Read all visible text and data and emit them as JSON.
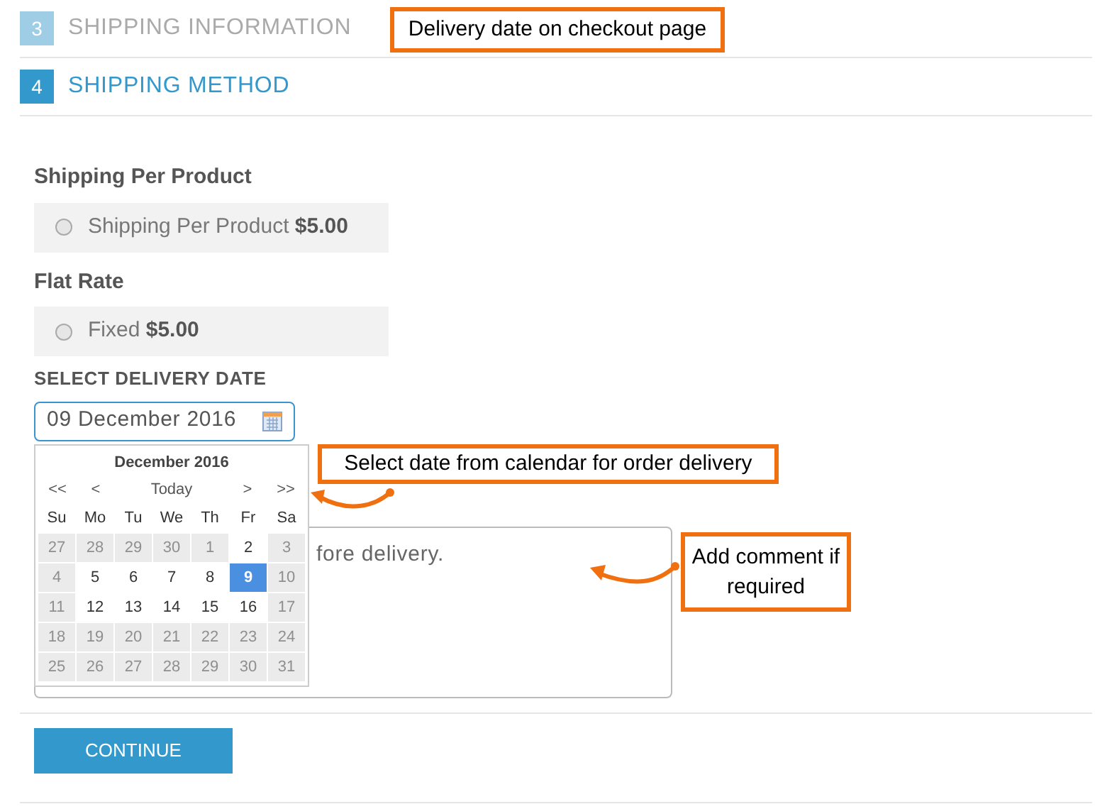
{
  "steps": [
    {
      "number": "3",
      "title": "SHIPPING INFORMATION",
      "active": false
    },
    {
      "number": "4",
      "title": "SHIPPING METHOD",
      "active": true
    }
  ],
  "methods": [
    {
      "heading": "Shipping Per Product",
      "option": "Shipping Per Product",
      "price": "$5.00",
      "selected": false
    },
    {
      "heading": "Flat Rate",
      "option": "Fixed",
      "price": "$5.00",
      "selected": false
    }
  ],
  "delivery_date": {
    "label": "SELECT DELIVERY DATE",
    "value": "09 December 2016"
  },
  "calendar": {
    "month": "December 2016",
    "nav": [
      "<<",
      "<",
      "Today",
      ">",
      ">>"
    ],
    "weekdays": [
      "Su",
      "Mo",
      "Tu",
      "We",
      "Th",
      "Fr",
      "Sa"
    ],
    "weeks": [
      [
        {
          "day": "27",
          "disabled": true,
          "selected": false
        },
        {
          "day": "28",
          "disabled": true,
          "selected": false
        },
        {
          "day": "29",
          "disabled": true,
          "selected": false
        },
        {
          "day": "30",
          "disabled": true,
          "selected": false
        },
        {
          "day": "1",
          "disabled": true,
          "selected": false
        },
        {
          "day": "2",
          "disabled": false,
          "selected": false
        },
        {
          "day": "3",
          "disabled": true,
          "selected": false
        }
      ],
      [
        {
          "day": "4",
          "disabled": true,
          "selected": false
        },
        {
          "day": "5",
          "disabled": false,
          "selected": false
        },
        {
          "day": "6",
          "disabled": false,
          "selected": false
        },
        {
          "day": "7",
          "disabled": false,
          "selected": false
        },
        {
          "day": "8",
          "disabled": false,
          "selected": false
        },
        {
          "day": "9",
          "disabled": false,
          "selected": true
        },
        {
          "day": "10",
          "disabled": true,
          "selected": false
        }
      ],
      [
        {
          "day": "11",
          "disabled": true,
          "selected": false
        },
        {
          "day": "12",
          "disabled": false,
          "selected": false
        },
        {
          "day": "13",
          "disabled": false,
          "selected": false
        },
        {
          "day": "14",
          "disabled": false,
          "selected": false
        },
        {
          "day": "15",
          "disabled": false,
          "selected": false
        },
        {
          "day": "16",
          "disabled": false,
          "selected": false
        },
        {
          "day": "17",
          "disabled": true,
          "selected": false
        }
      ],
      [
        {
          "day": "18",
          "disabled": true,
          "selected": false
        },
        {
          "day": "19",
          "disabled": true,
          "selected": false
        },
        {
          "day": "20",
          "disabled": true,
          "selected": false
        },
        {
          "day": "21",
          "disabled": true,
          "selected": false
        },
        {
          "day": "22",
          "disabled": true,
          "selected": false
        },
        {
          "day": "23",
          "disabled": true,
          "selected": false
        },
        {
          "day": "24",
          "disabled": true,
          "selected": false
        }
      ],
      [
        {
          "day": "25",
          "disabled": true,
          "selected": false
        },
        {
          "day": "26",
          "disabled": true,
          "selected": false
        },
        {
          "day": "27",
          "disabled": true,
          "selected": false
        },
        {
          "day": "28",
          "disabled": true,
          "selected": false
        },
        {
          "day": "29",
          "disabled": true,
          "selected": false
        },
        {
          "day": "30",
          "disabled": true,
          "selected": false
        },
        {
          "day": "31",
          "disabled": true,
          "selected": false
        }
      ]
    ]
  },
  "comment": {
    "value": "fore delivery."
  },
  "continue_button": "CONTINUE",
  "annotations": [
    "Delivery date on checkout page",
    "Select date from calendar for order delivery",
    "Add comment if required"
  ]
}
